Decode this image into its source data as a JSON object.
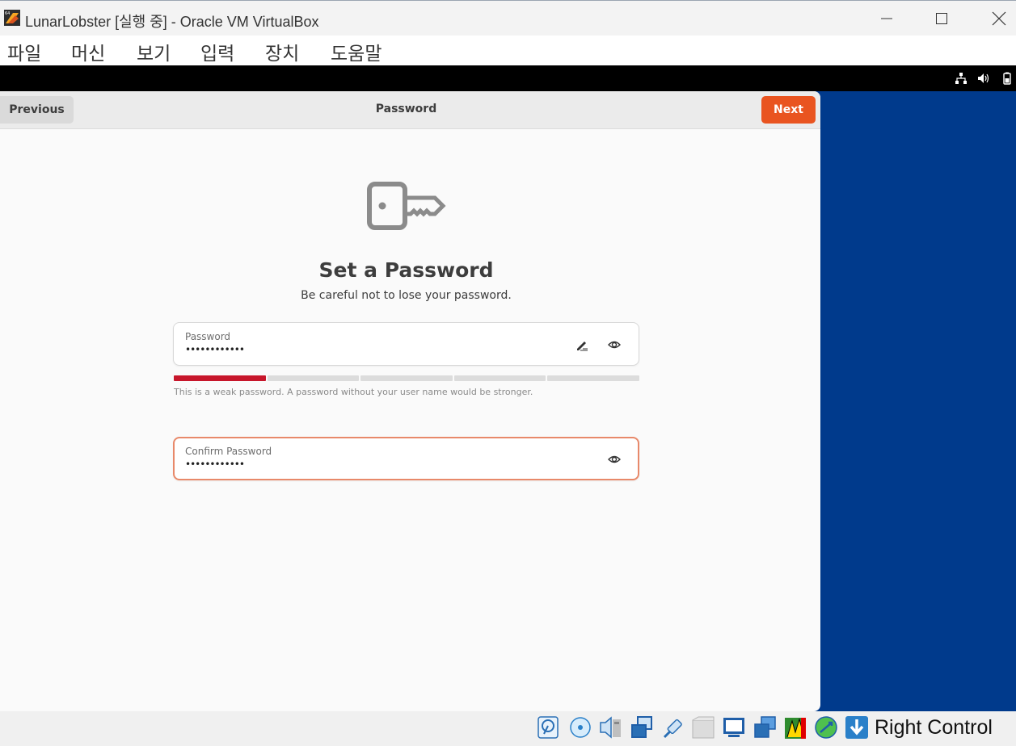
{
  "window": {
    "title": "LunarLobster [실행 중] - Oracle VM VirtualBox",
    "app_icon": "virtualbox-icon",
    "controls": [
      "minimize-icon",
      "maximize-icon",
      "close-icon"
    ]
  },
  "menubar": {
    "items": [
      "파일",
      "머신",
      "보기",
      "입력",
      "장치",
      "도움말"
    ]
  },
  "guest_panel": {
    "tray_icons": [
      "network-icon",
      "volume-icon",
      "battery-icon"
    ]
  },
  "installer": {
    "header": {
      "previous_label": "Previous",
      "title": "Password",
      "next_label": "Next"
    },
    "heading": "Set a Password",
    "subtitle": "Be careful not to lose your password.",
    "password_field": {
      "label": "Password",
      "value": "••••••••••••",
      "icons": [
        "edit-icon",
        "show-password-icon"
      ]
    },
    "strength": {
      "filled_segments": 1,
      "total_segments": 5,
      "color": "#c7162b",
      "hint": "This is a weak password. A password without your user name would be stronger."
    },
    "confirm_field": {
      "label": "Confirm Password",
      "value": "••••••••••••",
      "icons": [
        "show-password-icon"
      ]
    },
    "accent_color": "#e95420"
  },
  "statusbar": {
    "icons": [
      "hard-disk-icon",
      "optical-drive-icon",
      "audio-icon",
      "network-adapter-icon",
      "usb-icon",
      "shared-folders-icon",
      "display-icon",
      "video-capture-icon",
      "cpu-activity-icon",
      "mouse-integration-icon",
      "keyboard-capture-icon"
    ],
    "host_key": "Right Control"
  }
}
